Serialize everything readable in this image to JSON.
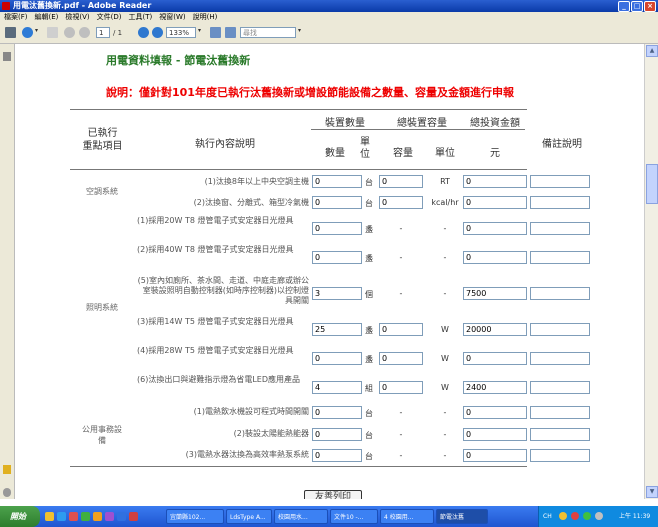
{
  "window": {
    "title": "用電汰舊換新.pdf - Adobe Reader"
  },
  "menu": [
    "檔案(F)",
    "編輯(E)",
    "檢視(V)",
    "文件(D)",
    "工具(T)",
    "視窗(W)",
    "說明(H)"
  ],
  "toolbar": {
    "page_current": "1",
    "page_total": "/ 1",
    "zoom": "133%",
    "search_placeholder": "尋找"
  },
  "form": {
    "title": "用電資料填報 - 節電汰舊換新",
    "description": "說明：僅針對101年度已執行汰舊換新或增設節能設備之數量、容量及金額進行申報",
    "headers": {
      "item": "已執行\n重點項目",
      "desc": "執行內容說明",
      "qty_group": "裝置數量",
      "cap_group": "總裝置容量",
      "inv_group": "總投資金額",
      "remark": "備註說明",
      "qty": "數量",
      "unit": "單\n位",
      "cap": "容量",
      "cap_unit": "單位",
      "amount": "元"
    },
    "categories": {
      "ac": "空調系統",
      "lighting": "照明系統",
      "public": "公用事務設\n備"
    },
    "rows": [
      {
        "desc": "(1)汰換8年以上中央空調主機",
        "qty": "0",
        "unit": "台",
        "cap": "0",
        "cap_unit": "RT",
        "amount": "0"
      },
      {
        "desc": "(2)汰換窗、分離式、箱型冷氣機",
        "qty": "0",
        "unit": "台",
        "cap": "0",
        "cap_unit": "kcal/hr",
        "amount": "0"
      },
      {
        "desc": "(1)採用20W T8 燈管電子式安定器日光燈具",
        "qty": "0",
        "unit": "盞",
        "cap": "-",
        "cap_unit": "-",
        "amount": "0"
      },
      {
        "desc": "(2)採用40W T8 燈管電子式安定器日光燈具",
        "qty": "0",
        "unit": "盞",
        "cap": "-",
        "cap_unit": "-",
        "amount": "0"
      },
      {
        "desc": "(5)室內如廁所、茶水間、走道、中庭走廊或辦公室裝設照明自動控制器(如時序控制器)以控制燈具開關",
        "qty": "3",
        "unit": "個",
        "cap": "-",
        "cap_unit": "-",
        "amount": "7500"
      },
      {
        "desc": "(3)採用14W T5 燈管電子式安定器日光燈具",
        "qty": "25",
        "unit": "盞",
        "cap": "0",
        "cap_unit": "W",
        "amount": "20000"
      },
      {
        "desc": "(4)採用28W T5 燈管電子式安定器日光燈具",
        "qty": "0",
        "unit": "盞",
        "cap": "0",
        "cap_unit": "W",
        "amount": "0"
      },
      {
        "desc": "(6)汰換出口與避難指示燈為省電LED應用產品",
        "qty": "4",
        "unit": "組",
        "cap": "0",
        "cap_unit": "W",
        "amount": "2400"
      },
      {
        "desc": "(1)電熱飲水機設可程式時間開關",
        "qty": "0",
        "unit": "台",
        "cap": "-",
        "cap_unit": "-",
        "amount": "0"
      },
      {
        "desc": "(2)裝設太陽能熱能器",
        "qty": "0",
        "unit": "台",
        "cap": "-",
        "cap_unit": "-",
        "amount": "0"
      },
      {
        "desc": "(3)電熱水器汰換為高效率熱泵系統",
        "qty": "0",
        "unit": "台",
        "cap": "-",
        "cap_unit": "-",
        "amount": "0"
      }
    ],
    "print_button": "友善列印"
  },
  "taskbar": {
    "start": "開始",
    "tasks": [
      "宜蘭縣102...",
      "LdsType A...",
      "校園用水...",
      "文件10 -...",
      "4 校園用...",
      "節電汰舊"
    ],
    "tray_lang": "CH",
    "clock": "上午 11:39"
  }
}
